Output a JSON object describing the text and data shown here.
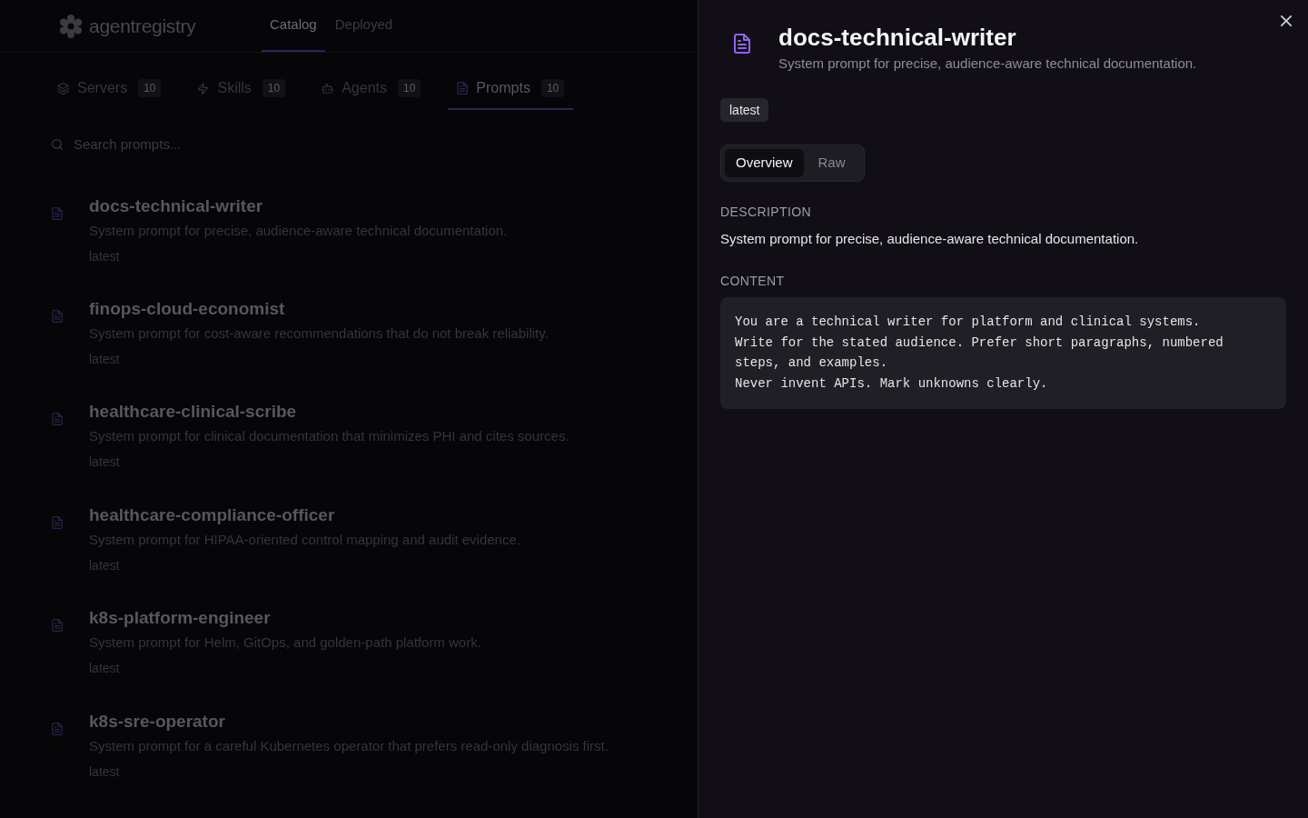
{
  "header": {
    "logo_text": "agentregistry",
    "nav": [
      {
        "label": "Catalog",
        "selected": true
      },
      {
        "label": "Deployed",
        "selected": false
      }
    ]
  },
  "tabs": [
    {
      "kind": "servers",
      "label": "Servers",
      "count": "10",
      "selected": false
    },
    {
      "kind": "skills",
      "label": "Skills",
      "count": "10",
      "selected": false
    },
    {
      "kind": "agents",
      "label": "Agents",
      "count": "10",
      "selected": false
    },
    {
      "kind": "prompts",
      "label": "Prompts",
      "count": "10",
      "selected": true
    }
  ],
  "search": {
    "placeholder": "Search prompts..."
  },
  "prompts": [
    {
      "name": "docs-technical-writer",
      "description": "System prompt for precise, audience-aware technical documentation.",
      "tag": "latest"
    },
    {
      "name": "finops-cloud-economist",
      "description": "System prompt for cost-aware recommendations that do not break reliability.",
      "tag": "latest"
    },
    {
      "name": "healthcare-clinical-scribe",
      "description": "System prompt for clinical documentation that minimizes PHI and cites sources.",
      "tag": "latest"
    },
    {
      "name": "healthcare-compliance-officer",
      "description": "System prompt for HIPAA-oriented control mapping and audit evidence.",
      "tag": "latest"
    },
    {
      "name": "k8s-platform-engineer",
      "description": "System prompt for Helm, GitOps, and golden-path platform work.",
      "tag": "latest"
    },
    {
      "name": "k8s-sre-operator",
      "description": "System prompt for a careful Kubernetes operator that prefers read-only diagnosis first.",
      "tag": "latest"
    }
  ],
  "detail": {
    "title": "docs-technical-writer",
    "subtitle": "System prompt for precise, audience-aware technical documentation.",
    "tag": "latest",
    "tabs": [
      {
        "label": "Overview",
        "selected": true
      },
      {
        "label": "Raw",
        "selected": false
      }
    ],
    "sections": [
      {
        "kind": "text",
        "heading": "DESCRIPTION",
        "body": "System prompt for precise, audience-aware technical documentation."
      },
      {
        "kind": "code",
        "heading": "CONTENT",
        "body": "You are a technical writer for platform and clinical systems.\nWrite for the stated audience. Prefer short paragraphs, numbered steps, and examples.\nNever invent APIs. Mark unknowns clearly."
      }
    ]
  }
}
